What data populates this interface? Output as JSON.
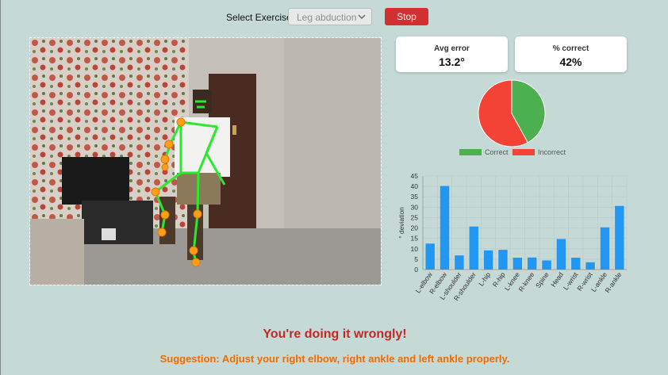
{
  "controls": {
    "select_label": "Select Exercise:",
    "exercise_value": "Leg abduction",
    "stop_label": "Stop"
  },
  "stats": {
    "avg_error_label": "Avg error",
    "avg_error_value": "13.2°",
    "pct_correct_label": "% correct",
    "pct_correct_value": "42%"
  },
  "chart_data": [
    {
      "type": "pie",
      "labels": [
        "Correct",
        "Incorrect"
      ],
      "values": [
        42,
        58
      ],
      "colors": [
        "#4caf50",
        "#f44336"
      ],
      "legend_position": "bottom"
    },
    {
      "type": "bar",
      "categories": [
        "L-elbow",
        "R-elbow",
        "L-shoulder",
        "R-shoulder",
        "L-hip",
        "R-hip",
        "L-knee",
        "R-knee",
        "Spine",
        "Head",
        "L-wrist",
        "R-wrist",
        "L-ankle",
        "R-ankle"
      ],
      "values": [
        12.5,
        40.2,
        6.8,
        20.7,
        9.2,
        9.5,
        5.7,
        5.8,
        4.4,
        14.7,
        5.7,
        3.5,
        20.3,
        30.6
      ],
      "ylabel": "° deviation",
      "ylim": [
        0,
        45
      ],
      "yticks": [
        0,
        5,
        10,
        15,
        20,
        25,
        30,
        35,
        40,
        45
      ],
      "grid": true,
      "color": "#2196f3"
    }
  ],
  "feedback": {
    "status": "You're doing it wrongly!",
    "suggestion": "Suggestion: Adjust your right elbow, right ankle and left ankle properly."
  }
}
